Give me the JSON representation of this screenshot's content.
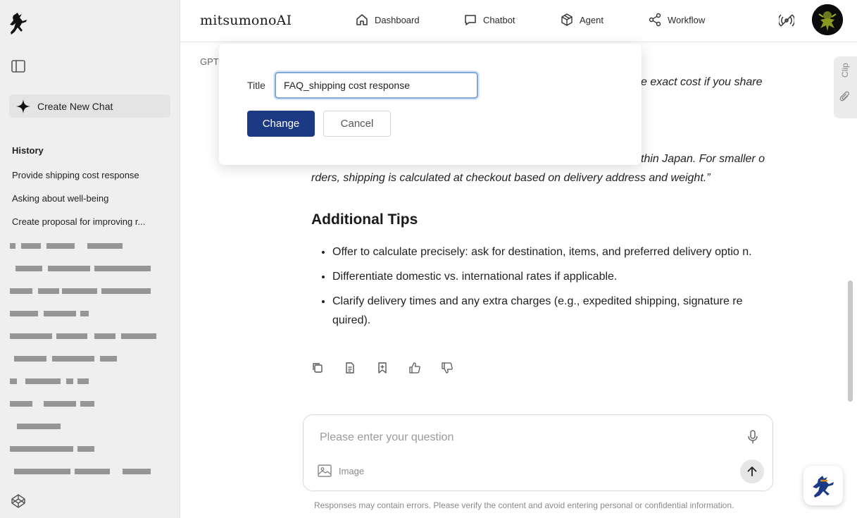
{
  "app": {
    "brand": "mitsumonoAI"
  },
  "nav": [
    {
      "label": "Dashboard",
      "icon": "home-icon"
    },
    {
      "label": "Chatbot",
      "icon": "chat-icon"
    },
    {
      "label": "Agent",
      "icon": "box-icon"
    },
    {
      "label": "Workflow",
      "icon": "share-icon"
    }
  ],
  "sidebar": {
    "new_chat_label": "Create New Chat",
    "history_title": "History",
    "history": [
      "Provide shipping cost response",
      "Asking about well-being",
      "Create proposal for improving r..."
    ]
  },
  "main": {
    "model_label": "GPT",
    "para1_tail": "e exact cost if you share",
    "para2_line1": "thin Japan. For smaller o",
    "para2_line2": "rders, shipping is calculated at checkout based on delivery address and weight.”",
    "section_title": "Additional Tips",
    "bullets": [
      "Offer to calculate precisely: ask for destination, items, and preferred delivery optio n.",
      "Differentiate domestic vs. international rates if applicable.",
      "Clarify delivery times and any extra charges (e.g., expedited shipping, signature re quired)."
    ],
    "clip_label": "Clip"
  },
  "composer": {
    "placeholder": "Please enter your question",
    "image_label": "Image",
    "disclaimer": "Responses may contain errors. Please verify the content and avoid entering personal or confidential information."
  },
  "modal": {
    "title_label": "Title",
    "title_value": "FAQ_shipping cost response",
    "change_label": "Change",
    "cancel_label": "Cancel"
  },
  "colors": {
    "primary": "#1c3a84",
    "sidebar_bg": "#efefef"
  }
}
